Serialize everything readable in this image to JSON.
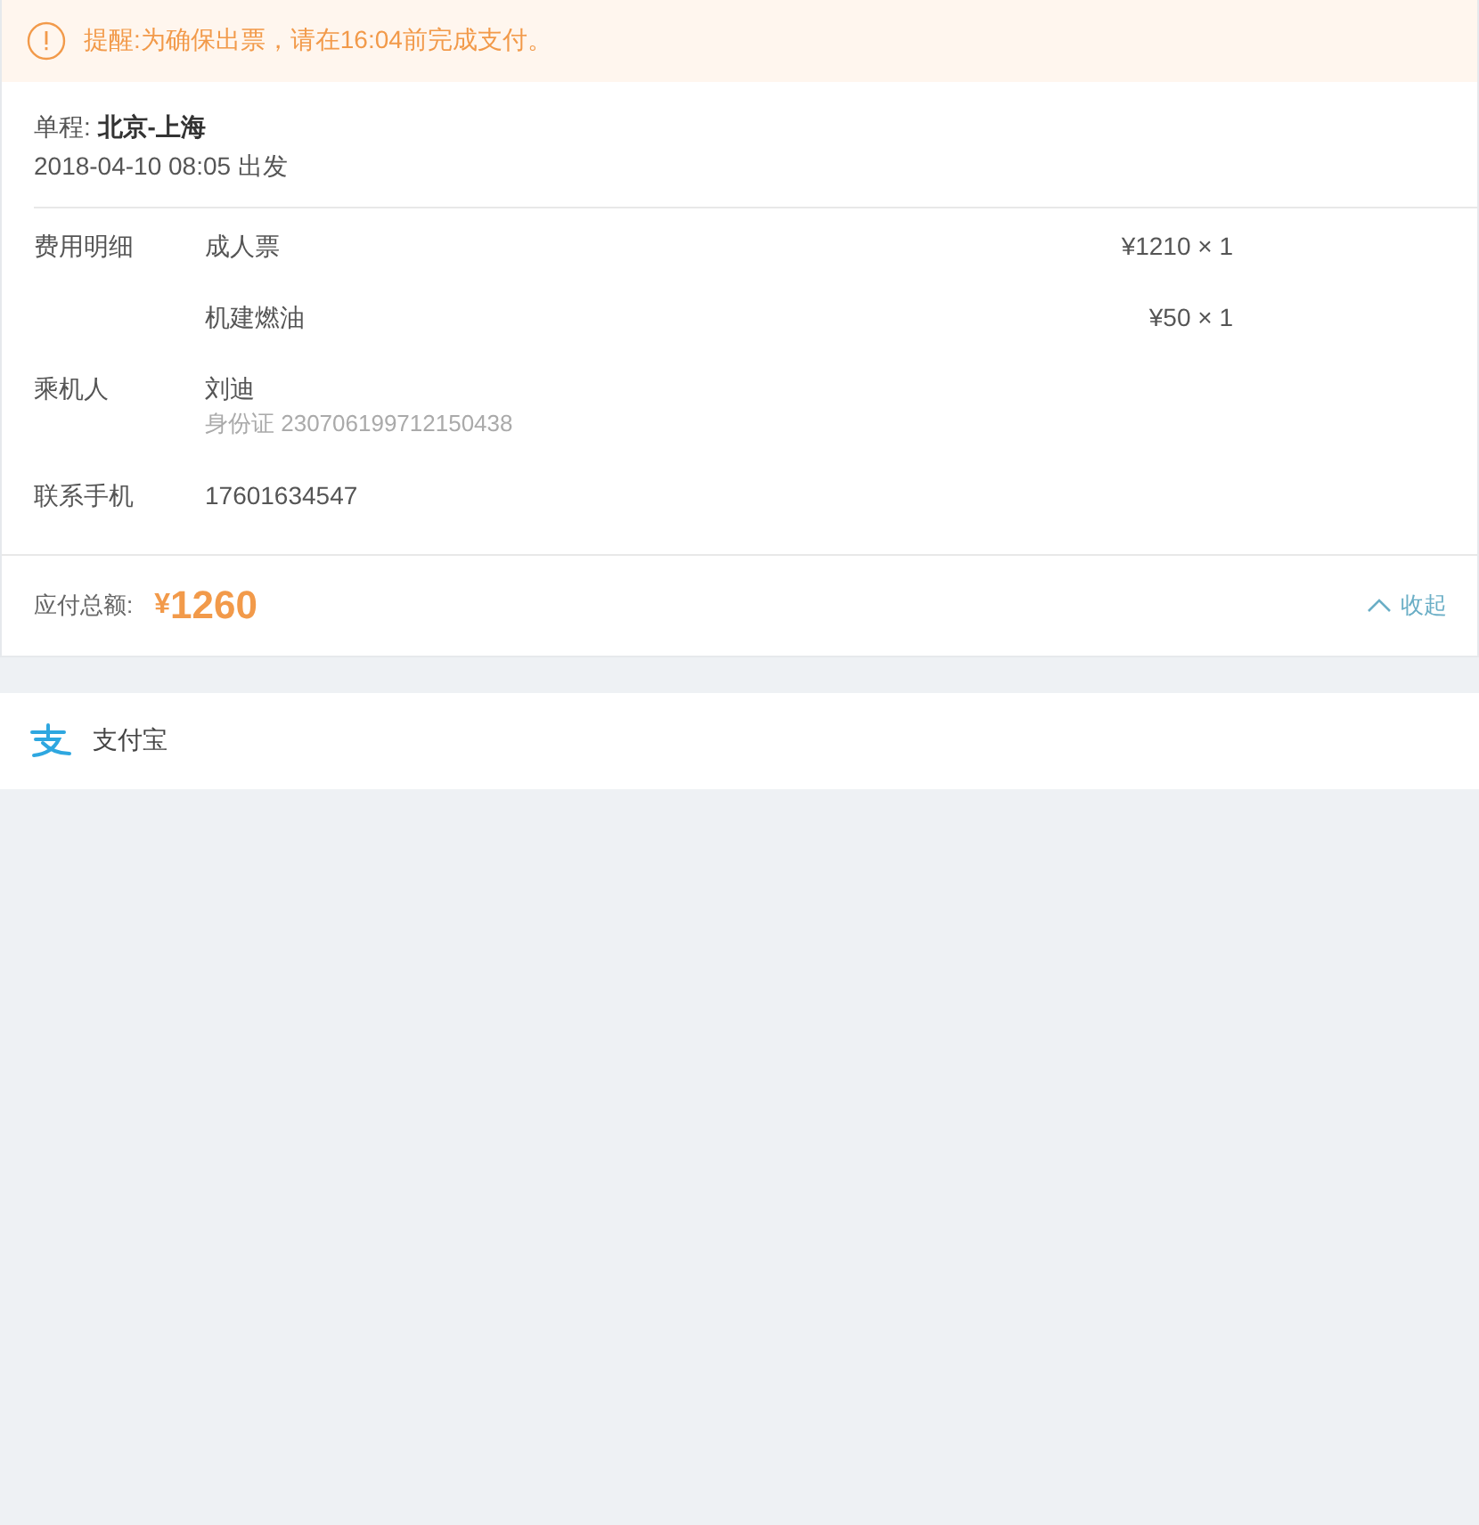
{
  "notice": {
    "text": "提醒:为确保出票，请在16:04前完成支付。"
  },
  "trip": {
    "label": "单程:",
    "route": "北京-上海",
    "departure": "2018-04-10 08:05 出发"
  },
  "details": {
    "expanded": true,
    "fees": {
      "label": "费用明细",
      "items": [
        {
          "name": "成人票",
          "price": "¥1210 × 1"
        },
        {
          "name": "机建燃油",
          "price": "¥50 × 1"
        }
      ]
    },
    "passenger": {
      "label": "乘机人",
      "name": "刘迪",
      "id": "身份证 230706199712150438"
    },
    "phone": {
      "label": "联系手机",
      "value": "17601634547"
    }
  },
  "total": {
    "label": "应付总额:",
    "currency": "¥",
    "amount": "1260",
    "toggle": "收起"
  },
  "payment": {
    "method": "支付宝"
  }
}
